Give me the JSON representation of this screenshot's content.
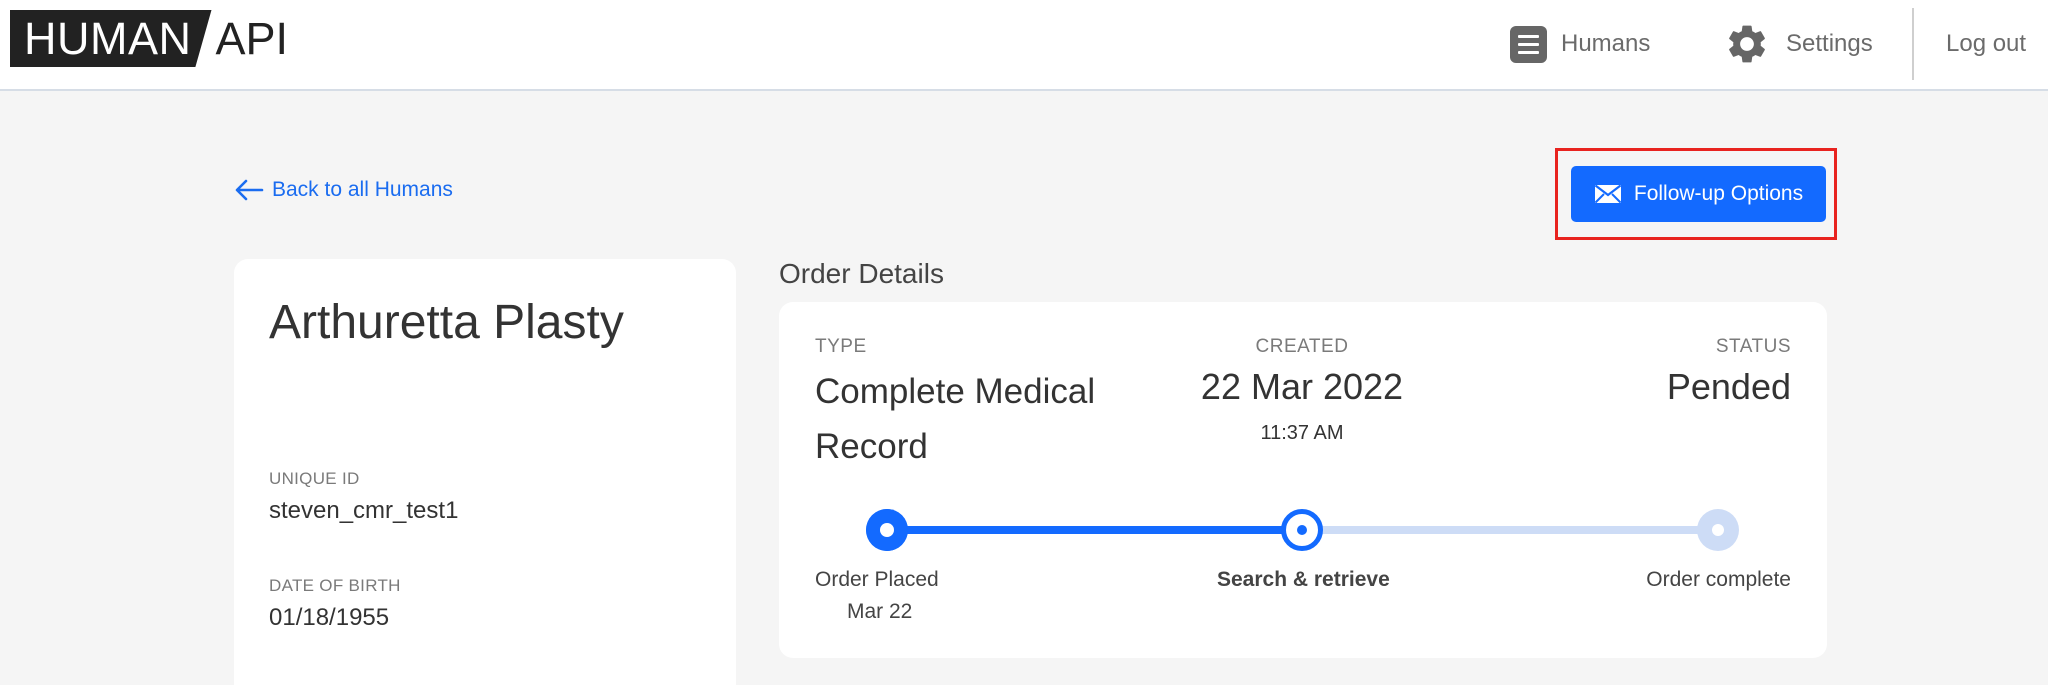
{
  "logo": {
    "part1": "HUMAN",
    "part2": "API"
  },
  "nav": {
    "humans": "Humans",
    "settings": "Settings",
    "logout": "Log out"
  },
  "back_link": "Back to all Humans",
  "followup_button": "Follow-up Options",
  "profile": {
    "name": "Arthuretta Plasty",
    "unique_id_label": "UNIQUE ID",
    "unique_id": "steven_cmr_test1",
    "dob_label": "DATE OF BIRTH",
    "dob": "01/18/1955"
  },
  "order": {
    "heading": "Order Details",
    "type_label": "TYPE",
    "type_value": "Complete Medical Record",
    "created_label": "CREATED",
    "created_date": "22 Mar 2022",
    "created_time": "11:37 AM",
    "status_label": "STATUS",
    "status_value": "Pended",
    "progress_fraction": 0.5,
    "steps": [
      {
        "label": "Order Placed",
        "sub": "Mar 22",
        "state": "done"
      },
      {
        "label": "Search & retrieve",
        "sub": "",
        "state": "current"
      },
      {
        "label": "Order complete",
        "sub": "",
        "state": "pending"
      }
    ]
  },
  "colors": {
    "accent": "#136aff",
    "highlight": "#e8231f",
    "track_inactive": "#cddcf6"
  }
}
